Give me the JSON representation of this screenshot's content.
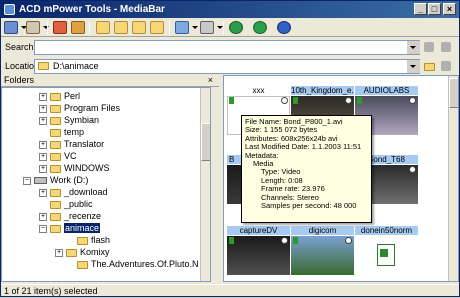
{
  "window": {
    "title": "ACD mPower Tools - MediaBar",
    "minimize_symbol": "_",
    "maximize_symbol": "□",
    "close_symbol": "×"
  },
  "toolbar": {
    "icons": [
      "browse-icon",
      "menu-icon",
      "move-icon",
      "copy-icon",
      "folder-up-icon",
      "new-folder-icon",
      "view-icon",
      "device-icon",
      "globe-icon",
      "dollar-icon",
      "help-icon"
    ]
  },
  "search": {
    "label": "Search",
    "value": "",
    "placeholder": ""
  },
  "location": {
    "label": "Location",
    "value": "D:\\animace"
  },
  "folders": {
    "header": "Folders",
    "items": [
      {
        "label": "Perl",
        "expander": "+"
      },
      {
        "label": "Program Files",
        "expander": "+"
      },
      {
        "label": "Symbian",
        "expander": "+"
      },
      {
        "label": "temp",
        "expander": ""
      },
      {
        "label": "Translator",
        "expander": "+"
      },
      {
        "label": "VC",
        "expander": "+"
      },
      {
        "label": "WINDOWS",
        "expander": "+"
      },
      {
        "label": "Work (D:)",
        "expander": "−"
      },
      {
        "label": "_download",
        "expander": "+"
      },
      {
        "label": "_public",
        "expander": ""
      },
      {
        "label": "_recenze",
        "expander": "+"
      },
      {
        "label": "animace",
        "expander": "−"
      },
      {
        "label": "flash",
        "expander": ""
      },
      {
        "label": "Komixy",
        "expander": "+"
      },
      {
        "label": "The.Adventures.Of.Pluto.Nash.DVDRip",
        "expander": ""
      }
    ]
  },
  "gallery": {
    "captions": [
      "xxx",
      "10th_Kingdom_e...",
      "AUDIOLABS",
      "B",
      "Bond_T68",
      "captureDV",
      "digicom",
      "donein50norm"
    ],
    "tooltip": {
      "file_name": "File Name: Bond_P800_1.avi",
      "size": "Size: 1 155 072 bytes",
      "attributes": "Attributes: 608x256x24b avi",
      "last_modified": "Last Modified Date: 1.1.2003 11:51",
      "metadata": "Metadata:",
      "media": "Media",
      "type": "Type: Video",
      "length": "Length: 0:08",
      "frame_rate": "Frame rate: 23.976",
      "channels": "Channels: Stereo",
      "samples": "Samples per second: 48 000"
    }
  },
  "status": {
    "text": "1 of 21 item(s) selected"
  },
  "colors": {
    "title_start": "#0a246a",
    "title_end": "#3a6ea5",
    "selection": "#0a246a",
    "caption_highlight": "#a6caf0",
    "tooltip_bg": "#ffffe1"
  }
}
